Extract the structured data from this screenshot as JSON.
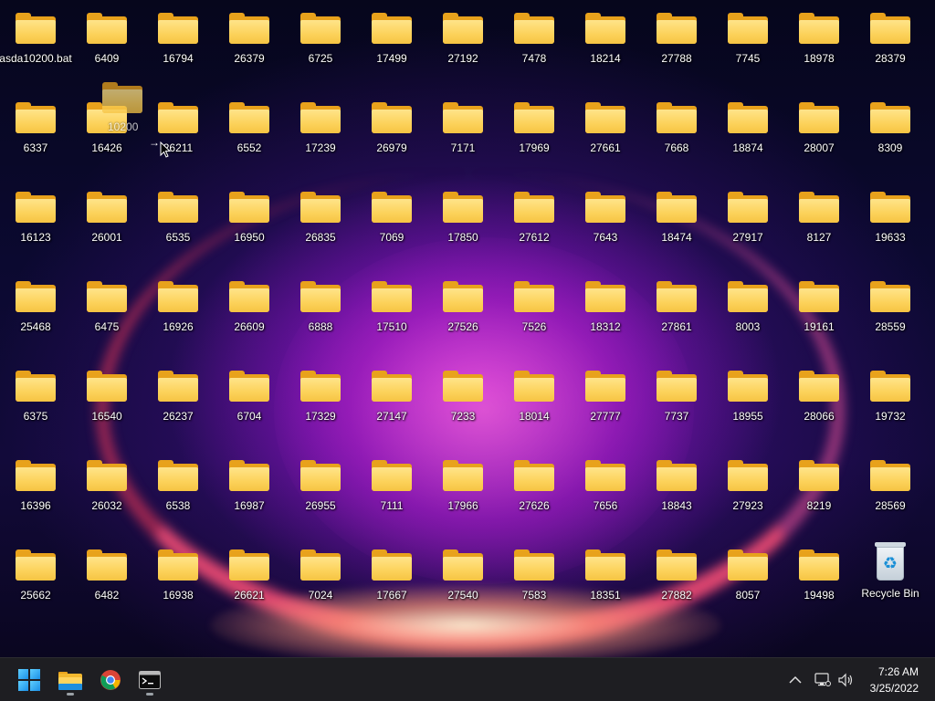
{
  "desktop": {
    "icons": [
      [
        "asda10200.bat",
        "6409",
        "16794",
        "26379",
        "6725",
        "17499",
        "27192",
        "7478",
        "18214",
        "27788",
        "7745",
        "18978",
        "28379"
      ],
      [
        "6337",
        "16426",
        "26211",
        "6552",
        "17239",
        "26979",
        "7171",
        "17969",
        "27661",
        "7668",
        "18874",
        "28007",
        "8309"
      ],
      [
        "16123",
        "26001",
        "6535",
        "16950",
        "26835",
        "7069",
        "17850",
        "27612",
        "7643",
        "18474",
        "27917",
        "8127",
        "19633"
      ],
      [
        "25468",
        "6475",
        "16926",
        "26609",
        "6888",
        "17510",
        "27526",
        "7526",
        "18312",
        "27861",
        "8003",
        "19161",
        "28559"
      ],
      [
        "6375",
        "16540",
        "26237",
        "6704",
        "17329",
        "27147",
        "7233",
        "18014",
        "27777",
        "7737",
        "18955",
        "28066",
        "19732"
      ],
      [
        "16396",
        "26032",
        "6538",
        "16987",
        "26955",
        "7111",
        "17966",
        "27626",
        "7656",
        "18843",
        "27923",
        "8219",
        "28569"
      ],
      [
        "25662",
        "6482",
        "16938",
        "26621",
        "7024",
        "17667",
        "27540",
        "7583",
        "18351",
        "27882",
        "8057",
        "19498",
        "Recycle Bin"
      ]
    ],
    "drag_ghost_label": "10200"
  },
  "taskbar": {
    "apps": [
      {
        "name": "start",
        "icon": "windows-logo-icon"
      },
      {
        "name": "file-explorer",
        "icon": "folder-icon",
        "running": true
      },
      {
        "name": "chrome",
        "icon": "chrome-icon",
        "running": false
      },
      {
        "name": "terminal",
        "icon": "terminal-icon",
        "running": true
      }
    ],
    "tray": {
      "time": "7:26 AM",
      "date": "3/25/2022"
    }
  },
  "colors": {
    "taskbar_bg": "#1e1e22",
    "folder_front": "#fcd25a",
    "folder_back": "#e8a21c",
    "accent_blue": "#1b8fe6"
  }
}
